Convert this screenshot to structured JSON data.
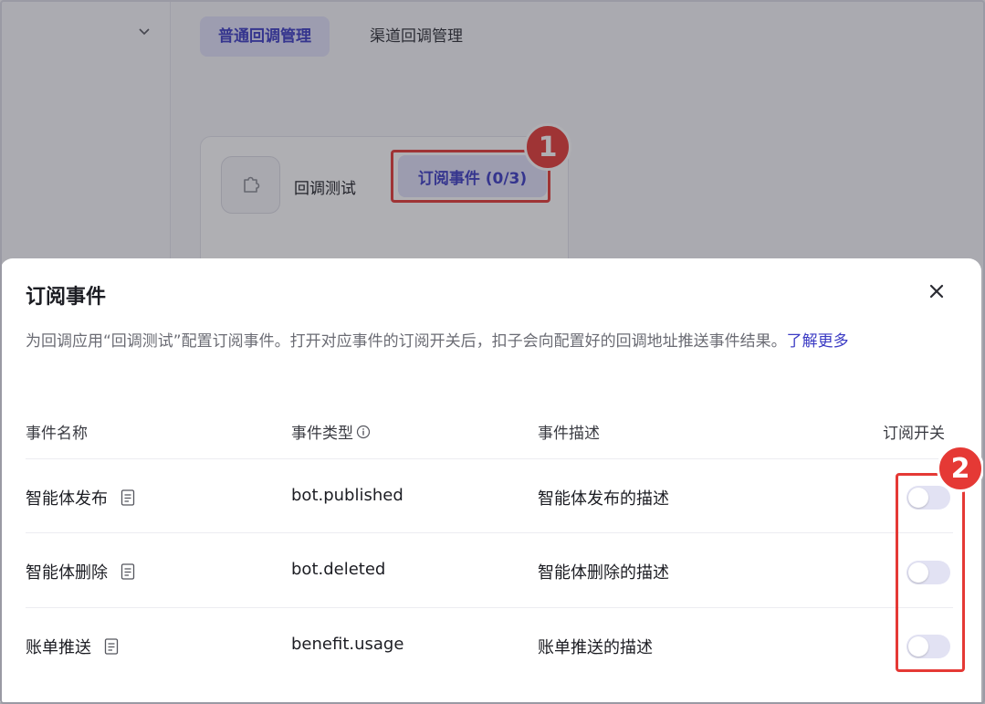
{
  "background": {
    "tabs": [
      {
        "label": "普通回调管理",
        "active": true
      },
      {
        "label": "渠道回调管理",
        "active": false
      }
    ],
    "app_card": {
      "icon": "puzzle-icon",
      "name": "回调测试",
      "subscribe_button": "订阅事件 (0/3)"
    }
  },
  "annotations": {
    "badge1": "1",
    "badge2": "2",
    "highlight_color": "#e53935"
  },
  "modal": {
    "title": "订阅事件",
    "description": "为回调应用“回调测试”配置订阅事件。打开对应事件的订阅开关后，扣子会向配置好的回调地址推送事件结果。",
    "learn_more": "了解更多",
    "columns": {
      "name": "事件名称",
      "type": "事件类型",
      "description": "事件描述",
      "switch": "订阅开关"
    },
    "rows": [
      {
        "name": "智能体发布",
        "type": "bot.published",
        "description": "智能体发布的描述",
        "enabled": false
      },
      {
        "name": "智能体删除",
        "type": "bot.deleted",
        "description": "智能体删除的描述",
        "enabled": false
      },
      {
        "name": "账单推送",
        "type": "benefit.usage",
        "description": "账单推送的描述",
        "enabled": false
      }
    ]
  },
  "colors": {
    "accent": "#3b3bc4",
    "accent_bg": "#e0e0f9",
    "toggle_off": "#e2e2f3"
  }
}
